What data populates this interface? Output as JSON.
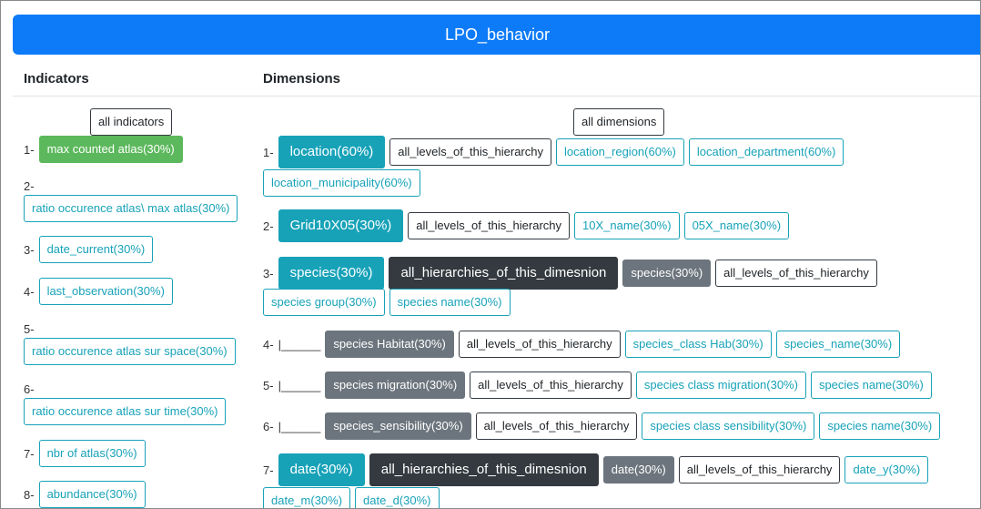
{
  "title": "LPO_behavior",
  "indicators": {
    "header": "Indicators",
    "all_label": "all indicators",
    "items": [
      {
        "n": "1-",
        "label": "max counted atlas(30%)"
      },
      {
        "n": "2-",
        "label": "ratio occurence atlas\\ max atlas(30%)"
      },
      {
        "n": "3-",
        "label": "date_current(30%)"
      },
      {
        "n": "4-",
        "label": "last_observation(30%)"
      },
      {
        "n": "5-",
        "label": "ratio occurence atlas sur space(30%)"
      },
      {
        "n": "6-",
        "label": "ratio occurence atlas sur time(30%)"
      },
      {
        "n": "7-",
        "label": "nbr of atlas(30%)"
      },
      {
        "n": "8-",
        "label": "abundance(30%)"
      }
    ]
  },
  "dimensions": {
    "header": "Dimensions",
    "all_label": "all dimensions",
    "d1": {
      "n": "1-",
      "main": "location(60%)",
      "all_levels": "all_levels_of_this_hierarchy",
      "levels": [
        "location_region(60%)",
        "location_department(60%)",
        "location_municipality(60%)"
      ]
    },
    "d2": {
      "n": "2-",
      "main": "Grid10X05(30%)",
      "all_levels": "all_levels_of_this_hierarchy",
      "levels": [
        "10X_name(30%)",
        "05X_name(30%)"
      ]
    },
    "d3": {
      "n": "3-",
      "main": "species(30%)",
      "all_hier": "all_hierarchies_of_this_dimesnion",
      "hier": "species(30%)",
      "all_levels": "all_levels_of_this_hierarchy",
      "levels": [
        "species group(30%)",
        "species name(30%)"
      ]
    },
    "d4": {
      "n": "4-",
      "branch": "|______",
      "hier": "species Habitat(30%)",
      "all_levels": "all_levels_of_this_hierarchy",
      "levels": [
        "species_class Hab(30%)",
        "species_name(30%)"
      ]
    },
    "d5": {
      "n": "5-",
      "branch": "|______",
      "hier": "species migration(30%)",
      "all_levels": "all_levels_of_this_hierarchy",
      "levels": [
        "species class migration(30%)",
        "species name(30%)"
      ]
    },
    "d6": {
      "n": "6-",
      "branch": "|______",
      "hier": "species_sensibility(30%)",
      "all_levels": "all_levels_of_this_hierarchy",
      "levels": [
        "species class sensibility(30%)",
        "species name(30%)"
      ]
    },
    "d7": {
      "n": "7-",
      "main": "date(30%)",
      "all_hier": "all_hierarchies_of_this_dimesnion",
      "hier": "date(30%)",
      "all_levels": "all_levels_of_this_hierarchy",
      "levels": [
        "date_y(30%)",
        "date_m(30%)",
        "date_d(30%)"
      ]
    }
  },
  "colors": {
    "primary": "#0d7bf7",
    "info": "#17a2b8",
    "dark": "#343a40",
    "secondary": "#6c757d",
    "success": "#5cb85c"
  }
}
